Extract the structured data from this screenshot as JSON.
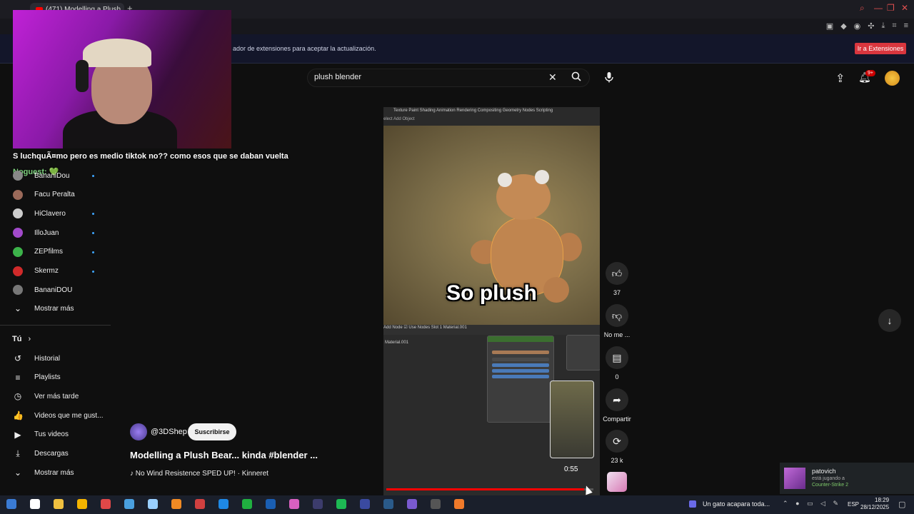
{
  "browser": {
    "tab_title": "(471) Modelling a Plush...",
    "notice_text": "ador de extensiones para aceptar la actualización.",
    "notice_button": "Ir a Extensiones"
  },
  "header": {
    "search_value": "plush blender",
    "notification_badge": "9+"
  },
  "chat": {
    "line1": "S luchquÃ¤mo pero es medio tiktok no?? como esos que se daban vuelta",
    "line2": "Noguest: 💚"
  },
  "sidebar": {
    "subscriptions": [
      {
        "label": "BananiDou",
        "live": true,
        "color": "#888888"
      },
      {
        "label": "Facu Peralta",
        "live": false,
        "color": "#9b6a5a"
      },
      {
        "label": "HiClavero",
        "live": true,
        "color": "#cccccc"
      },
      {
        "label": "IlloJuan",
        "live": true,
        "color": "#a24acb"
      },
      {
        "label": "ZEPfilms",
        "live": true,
        "color": "#3cb34a"
      },
      {
        "label": "Skermz",
        "live": true,
        "color": "#d02a2a"
      },
      {
        "label": "BananiDOU",
        "live": false,
        "color": "#777777"
      }
    ],
    "show_more": "Mostrar más",
    "you_label": "Tú",
    "you_items": [
      {
        "label": "Historial",
        "icon": "history-icon",
        "glyph": "↺"
      },
      {
        "label": "Playlists",
        "icon": "playlist-icon",
        "glyph": "≡"
      },
      {
        "label": "Ver más tarde",
        "icon": "clock-icon",
        "glyph": "◷"
      },
      {
        "label": "Videos que me gust...",
        "icon": "thumbs-up-icon",
        "glyph": "👍"
      },
      {
        "label": "Tus videos",
        "icon": "video-icon",
        "glyph": "▶"
      },
      {
        "label": "Descargas",
        "icon": "download-icon",
        "glyph": "⤓"
      }
    ],
    "show_more_2": "Mostrar más"
  },
  "short": {
    "caption": "So plush",
    "time": "0:55",
    "progress": 0.955,
    "blender_tabs": "Texture Paint   Shading   Animation   Rendering   Compositing   Geometry Nodes   Scripting",
    "blender_menu": "elect   Add   Object",
    "node_bar": "Add   Node   ☑ Use Nodes        Slot 1      Material.001",
    "material_label": "Material.001"
  },
  "actions": {
    "likes": "37",
    "dislike_label": "No me ...",
    "comments": "0",
    "share_label": "Compartir",
    "remix_count": "23 k"
  },
  "video": {
    "channel": "@3DShep",
    "subscribe": "Suscribirse",
    "title": "Modelling a Plush Bear... kinda #blender ...",
    "music": "♪ No Wind Resistence SPED UP! · Kinneret"
  },
  "toast": {
    "name": "patovich",
    "status": "está jugando a",
    "game": "Counter-Strike 2"
  },
  "taskbar": {
    "media": "Un gato acapara toda...",
    "lang": "ESP",
    "time": "18:29",
    "date": "28/12/2025"
  },
  "colors": {
    "accent": "#ff0000",
    "notice_button": "#d9363e",
    "subscribe_bg": "#f1f1f1"
  }
}
